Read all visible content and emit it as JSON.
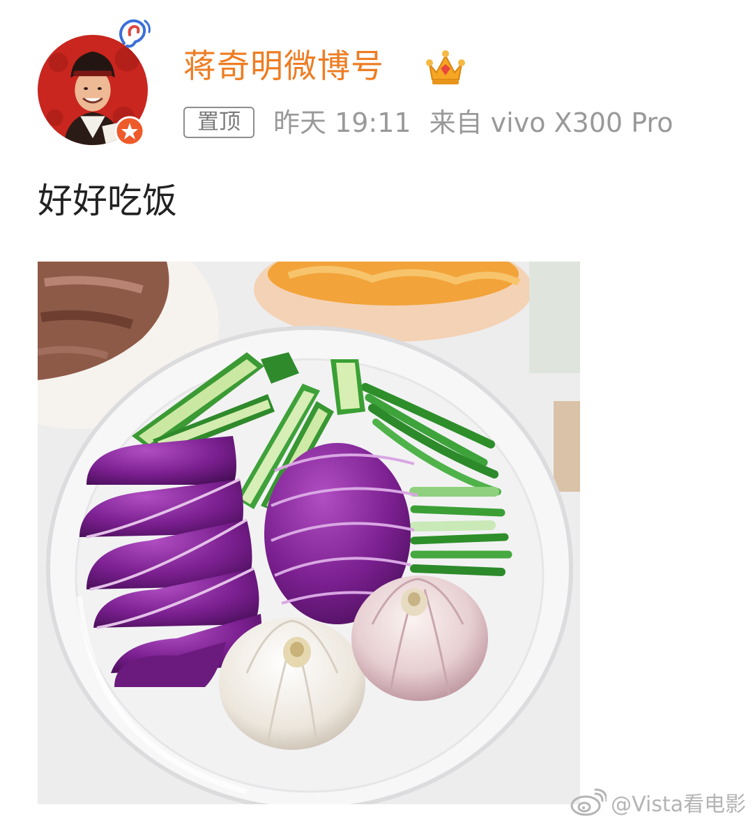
{
  "post": {
    "author": {
      "name": "蒋奇明微博号",
      "avatar_icon": "avatar-portrait",
      "hearing_badge_icon": "ear-badge-icon",
      "verify_badge_icon": "orange-v-verified-icon",
      "vip_icon": "gold-crown-icon"
    },
    "pinned_label": "置顶",
    "time": "昨天 19:11",
    "source": "来自 vivo X300 Pro",
    "text": "好好吃饭",
    "photo": {
      "icon": "food-photo",
      "subject": "plastic bowl of sliced red onion, cucumber strips, green onions and garlic bulbs"
    }
  },
  "watermark": {
    "logo_icon": "weibo-logo-icon",
    "handle": "@Vista看电影"
  },
  "colors": {
    "name": "#ee7d23",
    "meta": "#999999",
    "text": "#222222",
    "badge_border": "#8d8d8d",
    "watermark": "#b4b4b4"
  }
}
